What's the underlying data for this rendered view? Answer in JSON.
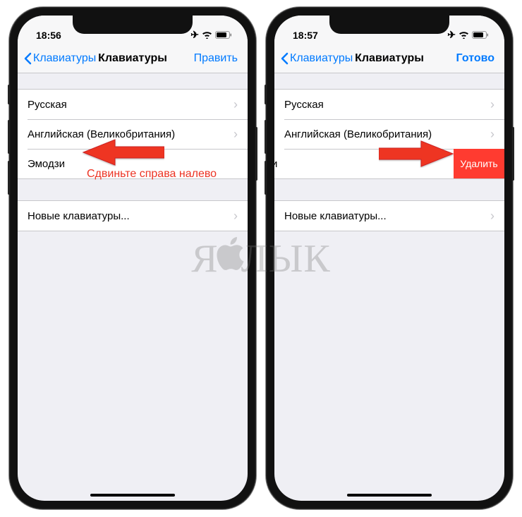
{
  "watermark": "ЯБЛЫК",
  "annotation_left": "Сдвиньте справа налево",
  "phone_left": {
    "time": "18:56",
    "nav": {
      "back": "Клавиатуры",
      "title": "Клавиатуры",
      "action": "Править"
    },
    "items": [
      "Русская",
      "Английская (Великобритания)",
      "Эмодзи"
    ],
    "new_kbd": "Новые клавиатуры..."
  },
  "phone_right": {
    "time": "18:57",
    "nav": {
      "back": "Клавиатуры",
      "title": "Клавиатуры",
      "action": "Готово"
    },
    "items": [
      "Русская",
      "Английская (Великобритания)"
    ],
    "swiped_item": "и",
    "delete_label": "Удалить",
    "new_kbd": "Новые клавиатуры..."
  }
}
